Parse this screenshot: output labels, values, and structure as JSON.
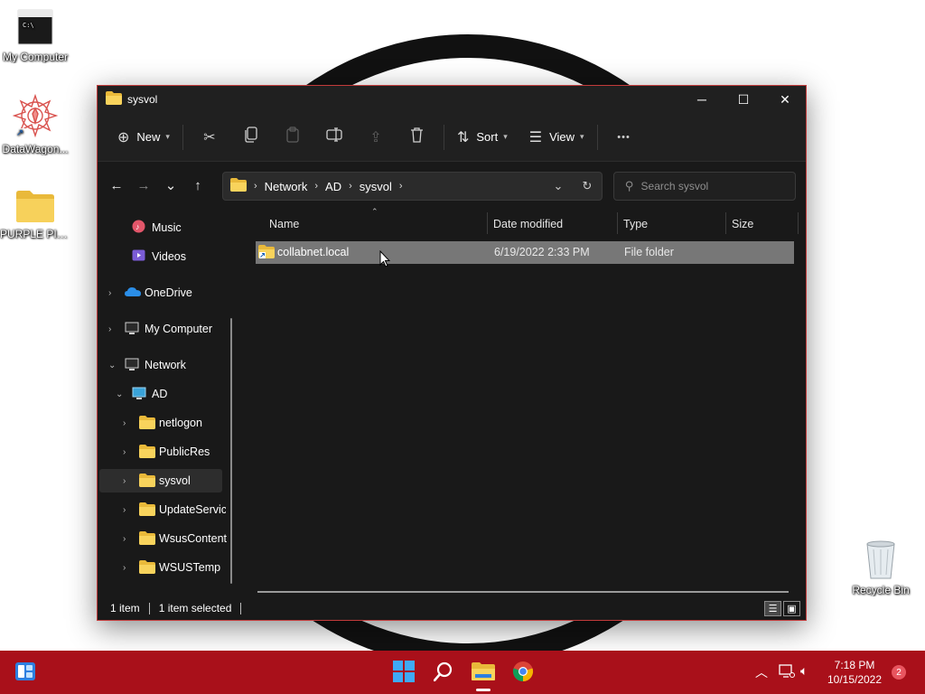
{
  "desktop": {
    "icons": [
      {
        "label": "My Computer",
        "icon": "terminal-icon"
      },
      {
        "label": "DataWagon...",
        "icon": "mandala-shortcut-icon"
      },
      {
        "label": "PURPLE PINK",
        "icon": "folder-icon"
      },
      {
        "label": "Recycle Bin",
        "icon": "recycle-bin-icon"
      }
    ]
  },
  "window": {
    "title": "sysvol",
    "controls": {
      "minimize": "─",
      "maximize": "☐",
      "close": "✕"
    }
  },
  "toolbar": {
    "new_label": "New",
    "sort_label": "Sort",
    "view_label": "View",
    "more_label": "•••"
  },
  "nav": {
    "back": "←",
    "forward": "→",
    "recent": "⌄",
    "up": "↑"
  },
  "address": {
    "segments": [
      "Network",
      "AD",
      "sysvol"
    ]
  },
  "search": {
    "placeholder": "Search sysvol"
  },
  "sidebar": {
    "items": [
      {
        "label": "Music",
        "icon": "music-icon"
      },
      {
        "label": "Videos",
        "icon": "videos-icon"
      },
      {
        "label": "OneDrive",
        "icon": "onedrive-icon"
      },
      {
        "label": "My Computer",
        "icon": "computer-icon"
      },
      {
        "label": "Network",
        "icon": "network-icon"
      },
      {
        "label": "AD",
        "icon": "network-drive-icon"
      },
      {
        "label": "netlogon",
        "icon": "folder-icon"
      },
      {
        "label": "PublicRes",
        "icon": "folder-icon"
      },
      {
        "label": "sysvol",
        "icon": "folder-icon"
      },
      {
        "label": "UpdateServicesPackages",
        "icon": "folder-icon"
      },
      {
        "label": "WsusContent",
        "icon": "folder-icon"
      },
      {
        "label": "WSUSTemp",
        "icon": "folder-icon"
      }
    ]
  },
  "columns": [
    "Name",
    "Date modified",
    "Type",
    "Size"
  ],
  "files": [
    {
      "name": "collabnet.local",
      "date_modified": "6/19/2022 2:33 PM",
      "type": "File folder",
      "size": ""
    }
  ],
  "status": {
    "count": "1 item",
    "selected": "1 item selected"
  },
  "taskbar": {
    "time": "7:18 PM",
    "date": "10/15/2022",
    "notifications": "2",
    "colors": {
      "taskbar": "#a9101a",
      "selection": "#777777"
    }
  }
}
